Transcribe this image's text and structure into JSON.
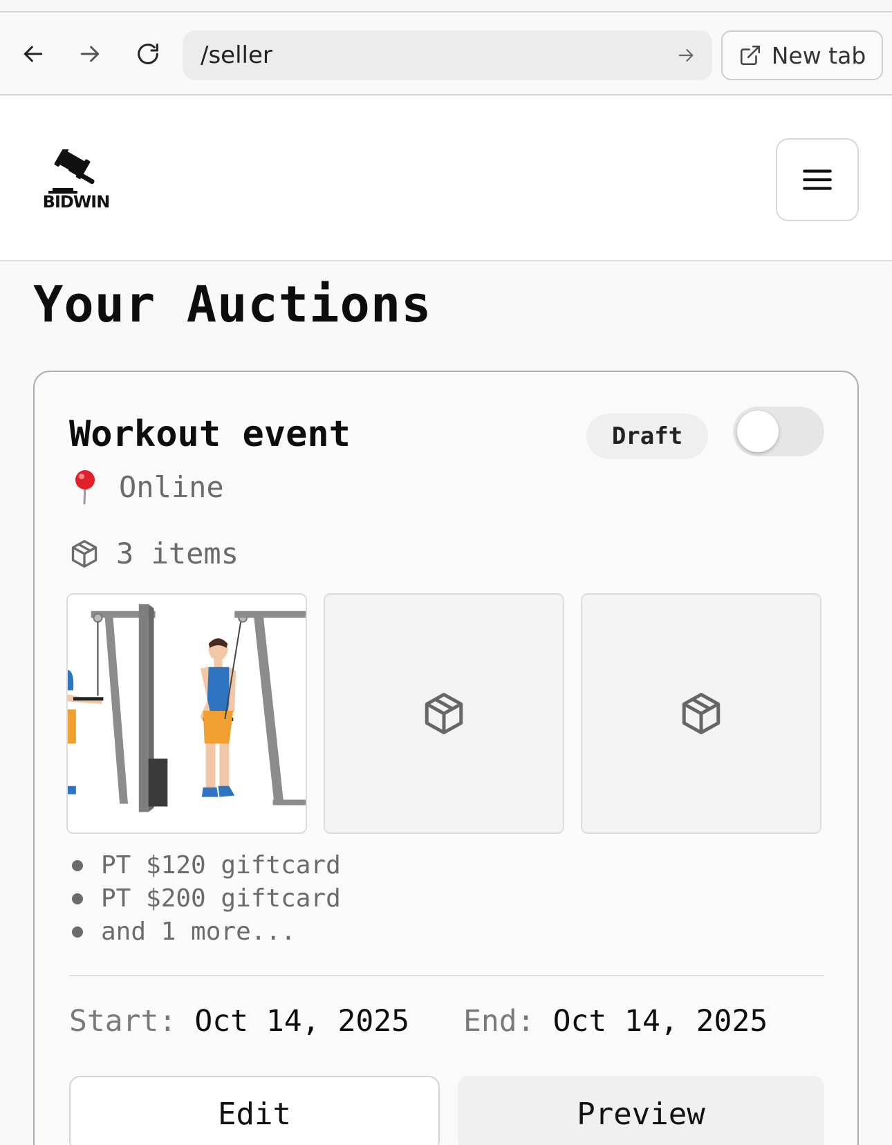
{
  "browser": {
    "url": "/seller",
    "new_tab_label": "New tab"
  },
  "header": {
    "logo_text": "BIDWIN"
  },
  "page": {
    "title": "Your Auctions"
  },
  "auction": {
    "title": "Workout event",
    "status": "Draft",
    "toggle_on": false,
    "location": "Online",
    "item_count": "3 items",
    "items": [
      "PT $120 giftcard",
      "PT $200 giftcard",
      "and 1 more..."
    ],
    "start_label": "Start:",
    "start_date": "Oct 14, 2025",
    "end_label": "End:",
    "end_date": "Oct 14, 2025",
    "edit_label": "Edit",
    "preview_label": "Preview"
  },
  "icons": {
    "back": "arrow-left-icon",
    "forward": "arrow-right-icon",
    "reload": "reload-icon",
    "go": "arrow-right-icon",
    "new_tab": "external-link-icon",
    "menu": "hamburger-menu-icon",
    "location": "pushpin-icon",
    "package": "package-icon"
  },
  "colors": {
    "pin_red": "#e0202a",
    "shorts_orange": "#f0a030",
    "shirt_blue": "#2f74c0"
  }
}
